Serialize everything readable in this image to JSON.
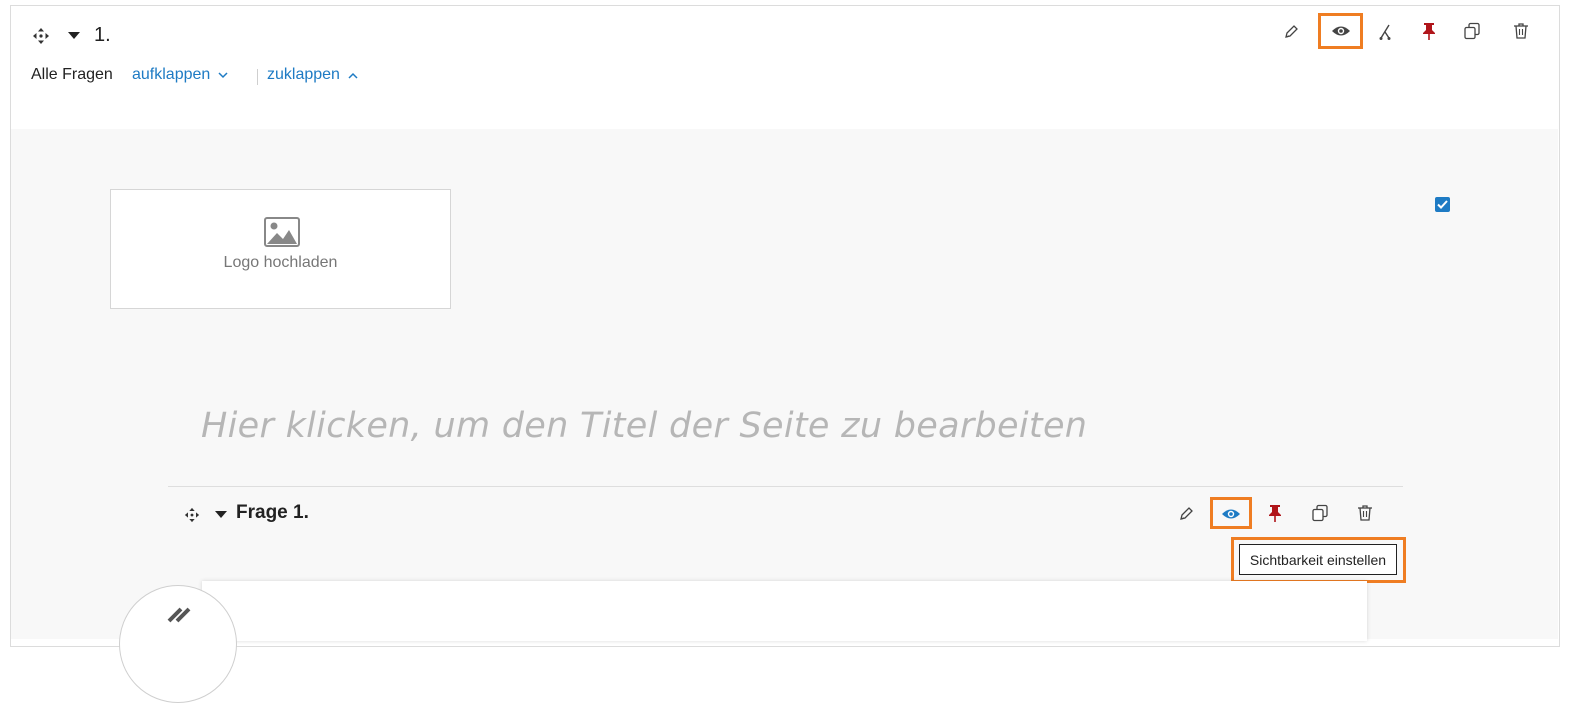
{
  "page": {
    "number_label": "1.",
    "all_questions_label": "Alle Fragen",
    "expand_label": "aufklappen",
    "collapse_label": "zuklappen",
    "logo_upload_label": "Logo hochladen",
    "title_placeholder": "Hier klicken, um den Titel der Seite zu bearbeiten",
    "visibility_checked": true
  },
  "question": {
    "title": "Frage 1.",
    "tooltip": "Sichtbarkeit einstellen"
  },
  "icons": {
    "page_toolbar": [
      "edit-icon",
      "eye-icon",
      "branch-icon",
      "pin-icon",
      "copy-icon",
      "trash-icon"
    ],
    "question_toolbar": [
      "edit-icon",
      "eye-icon",
      "pin-icon",
      "copy-icon",
      "trash-icon"
    ]
  },
  "colors": {
    "accent_blue": "#1e7bc4",
    "highlight_orange": "#ef7d22",
    "pin_red": "#b0151a",
    "placeholder_gray": "#b6b6b6",
    "panel_gray": "#f8f8f8"
  }
}
